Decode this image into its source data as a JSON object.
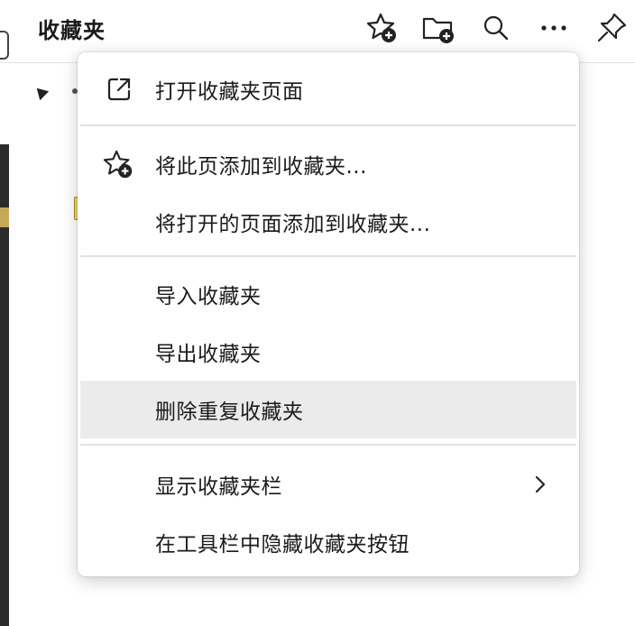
{
  "header": {
    "title": "收藏夹",
    "icons": [
      "add-favorite-icon",
      "add-folder-icon",
      "search-icon",
      "more-icon",
      "pin-icon"
    ]
  },
  "menu": {
    "items": [
      {
        "label": "打开收藏夹页面",
        "icon": "open-external-icon"
      },
      {
        "label": "将此页添加到收藏夹...",
        "icon": "add-favorite-icon"
      },
      {
        "label": "将打开的页面添加到收藏夹..."
      },
      {
        "label": "导入收藏夹"
      },
      {
        "label": "导出收藏夹"
      },
      {
        "label": "删除重复收藏夹",
        "highlighted": true
      },
      {
        "label": "显示收藏夹栏",
        "icon": "chevron-right-icon"
      },
      {
        "label": "在工具栏中隐藏收藏夹按钮"
      }
    ]
  }
}
